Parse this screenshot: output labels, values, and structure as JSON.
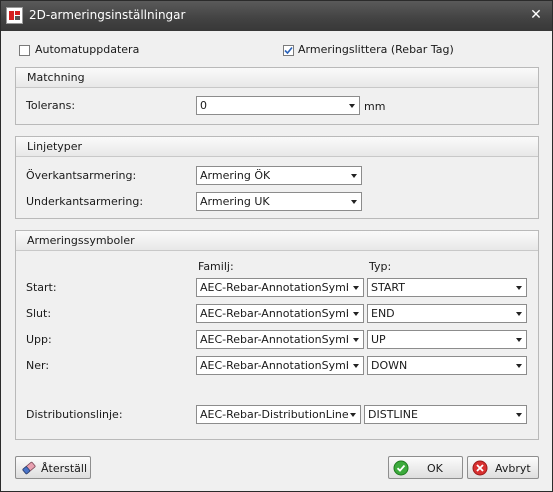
{
  "window": {
    "title": "2D-armeringsinställningar",
    "close_glyph": "✕",
    "icon": "app-icon"
  },
  "options": {
    "auto_update": {
      "label": "Automatuppdatera",
      "checked": false
    },
    "rebar_tag": {
      "label": "Armeringslittera (Rebar Tag)",
      "checked": true
    }
  },
  "matching": {
    "title": "Matchning",
    "tolerance_label": "Tolerans:",
    "tolerance_value": "0",
    "unit": "mm"
  },
  "linetypes": {
    "title": "Linjetyper",
    "top_label": "Överkantsarmering:",
    "top_value": "Armering ÖK",
    "bottom_label": "Underkantsarmering:",
    "bottom_value": "Armering UK"
  },
  "symbols": {
    "title": "Armeringssymboler",
    "family_header": "Familj:",
    "type_header": "Typ:",
    "rows": [
      {
        "label": "Start:",
        "family": "AEC-Rebar-AnnotationSymbol",
        "type": "START"
      },
      {
        "label": "Slut:",
        "family": "AEC-Rebar-AnnotationSymbol",
        "type": "END"
      },
      {
        "label": "Upp:",
        "family": "AEC-Rebar-AnnotationSymbol",
        "type": "UP"
      },
      {
        "label": "Ner:",
        "family": "AEC-Rebar-AnnotationSymbol",
        "type": "DOWN"
      }
    ],
    "distribution": {
      "label": "Distributionslinje:",
      "family": "AEC-Rebar-DistributionLine",
      "type": "DISTLINE"
    }
  },
  "buttons": {
    "reset": {
      "label": "Återställ",
      "icon": "eraser-icon"
    },
    "ok": {
      "label": "OK",
      "icon": "check-circle-icon"
    },
    "cancel": {
      "label": "Avbryt",
      "icon": "cancel-circle-icon"
    }
  },
  "colors": {
    "titlebar": "#424242",
    "ok_green": "#3caa3c",
    "cancel_red": "#d83030"
  }
}
